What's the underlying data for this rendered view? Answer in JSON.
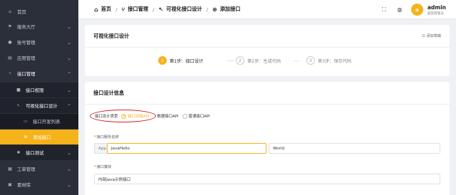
{
  "sidebar": {
    "items": [
      {
        "icon": "home-icon",
        "glyph": "⌂",
        "label": "首页",
        "arrow": ""
      },
      {
        "icon": "shop-icon",
        "glyph": "⚑",
        "label": "服务大厅",
        "arrow": "⌄"
      },
      {
        "icon": "user-icon",
        "glyph": "●",
        "label": "账号管理",
        "arrow": "⌄"
      },
      {
        "icon": "app-icon",
        "glyph": "▤",
        "label": "应用管理",
        "arrow": "⌄"
      },
      {
        "icon": "api-icon",
        "glyph": "⑂",
        "label": "接口管理",
        "arrow": "⌃"
      },
      {
        "icon": "lock-icon",
        "glyph": "■",
        "label": "接口权限",
        "arrow": "⌄"
      },
      {
        "icon": "design-icon",
        "glyph": "↖",
        "label": "可视化接口设计",
        "arrow": "⌃"
      },
      {
        "icon": "list-icon",
        "glyph": "▭",
        "label": "接口开发列表",
        "arrow": ""
      },
      {
        "icon": "add-icon",
        "glyph": "⊕",
        "label": "添加接口",
        "arrow": ""
      },
      {
        "icon": "test-icon",
        "glyph": "✱",
        "label": "接口测试",
        "arrow": "⌄"
      },
      {
        "icon": "ticket-icon",
        "glyph": "▦",
        "label": "工单管理",
        "arrow": "⌄"
      },
      {
        "icon": "library-icon",
        "glyph": "▣",
        "label": "素材库",
        "arrow": "⌄"
      }
    ]
  },
  "header": {
    "breadcrumbs": [
      {
        "icon": "home-icon",
        "glyph": "⌂",
        "label": "首页"
      },
      {
        "icon": "api-icon",
        "glyph": "⑂",
        "label": "接口管理"
      },
      {
        "icon": "design-icon",
        "glyph": "↖",
        "label": "可视化接口设计"
      },
      {
        "icon": "add-icon",
        "glyph": "⊕",
        "label": "添加接口"
      }
    ],
    "separator": "/",
    "fullscreen_glyph": "⛶",
    "language_glyph": "◍",
    "avatar_letter": "a",
    "user_name": "admin",
    "user_role": "超级管理员"
  },
  "card1": {
    "title": "可视化接口设计",
    "draft_link": "⊡ 添加草稿",
    "steps": [
      {
        "num": "1",
        "label": "第1步：接口设计",
        "active": true
      },
      {
        "num": "2",
        "label": "第2步：生成代码",
        "active": false
      },
      {
        "num": "3",
        "label": "第3步：保存代码",
        "active": false
      }
    ]
  },
  "card2": {
    "title": "接口设计信息",
    "type_label": "接口设计类型",
    "type_options": [
      {
        "label": "接口对接API",
        "selected": true
      },
      {
        "label": "数据接口API",
        "selected": false
      },
      {
        "label": "普通接口API",
        "selected": false
      }
    ],
    "service_name_label": "接口服务名称",
    "service_prefix": "App.",
    "service_value": "JavaHello",
    "service_suffix": "World",
    "module_label": "接口模块",
    "module_value": "内部Java示例接口"
  },
  "colors": {
    "accent": "#f5b31b",
    "sidebar_bg": "#2b2f3a",
    "annotation_red": "#d8222a"
  }
}
